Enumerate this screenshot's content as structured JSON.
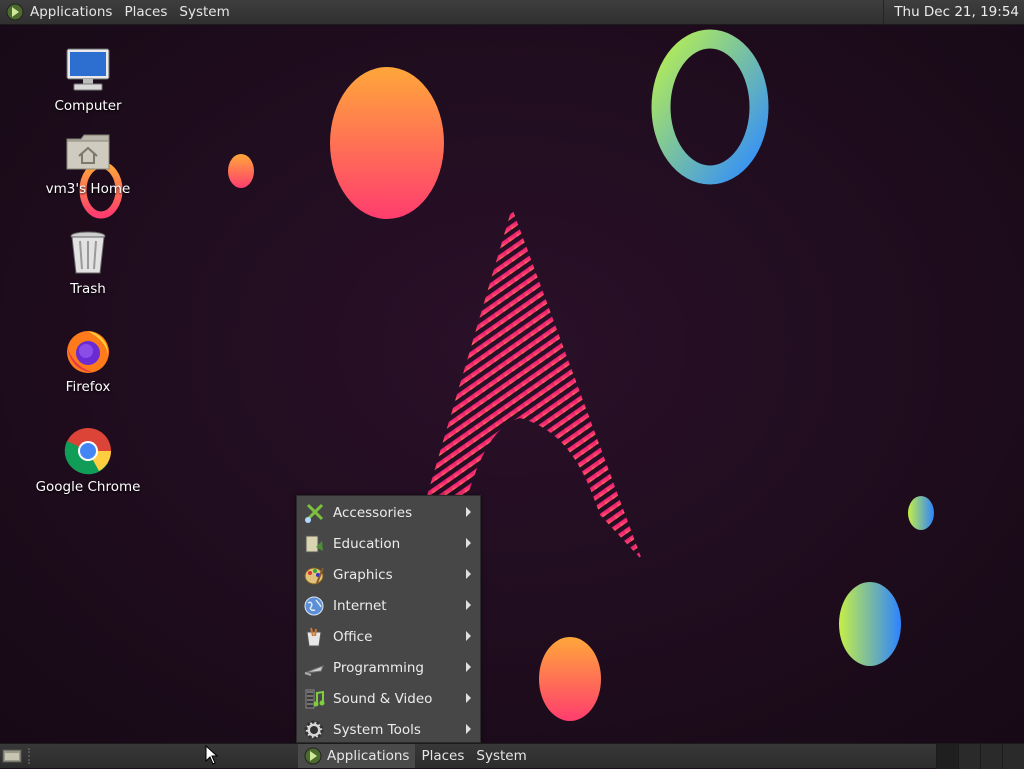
{
  "top_panel": {
    "menus": [
      "Applications",
      "Places",
      "System"
    ],
    "clock": "Thu Dec 21, 19:54"
  },
  "desktop_icons": [
    {
      "label": "Computer",
      "icon": "computer-icon"
    },
    {
      "label": "vm3's Home",
      "icon": "home-folder-icon"
    },
    {
      "label": "Trash",
      "icon": "trash-icon"
    },
    {
      "label": "Firefox",
      "icon": "firefox-icon"
    },
    {
      "label": "Google Chrome",
      "icon": "chrome-icon"
    }
  ],
  "app_menu": {
    "items": [
      {
        "label": "Accessories",
        "icon": "accessories-icon"
      },
      {
        "label": "Education",
        "icon": "education-icon"
      },
      {
        "label": "Graphics",
        "icon": "graphics-icon"
      },
      {
        "label": "Internet",
        "icon": "internet-icon"
      },
      {
        "label": "Office",
        "icon": "office-icon"
      },
      {
        "label": "Programming",
        "icon": "programming-icon"
      },
      {
        "label": "Sound & Video",
        "icon": "sound-video-icon"
      },
      {
        "label": "System Tools",
        "icon": "system-tools-icon"
      }
    ]
  },
  "bottom_panel": {
    "menus": [
      "Applications",
      "Places",
      "System"
    ],
    "active_menu": "Applications"
  },
  "colors": {
    "panel": "#333333",
    "menu_bg": "#474747",
    "wallpaper_bg": "#1d0d1c",
    "accent_pink": "#e8226f",
    "accent_orange": "#ffa03a"
  }
}
